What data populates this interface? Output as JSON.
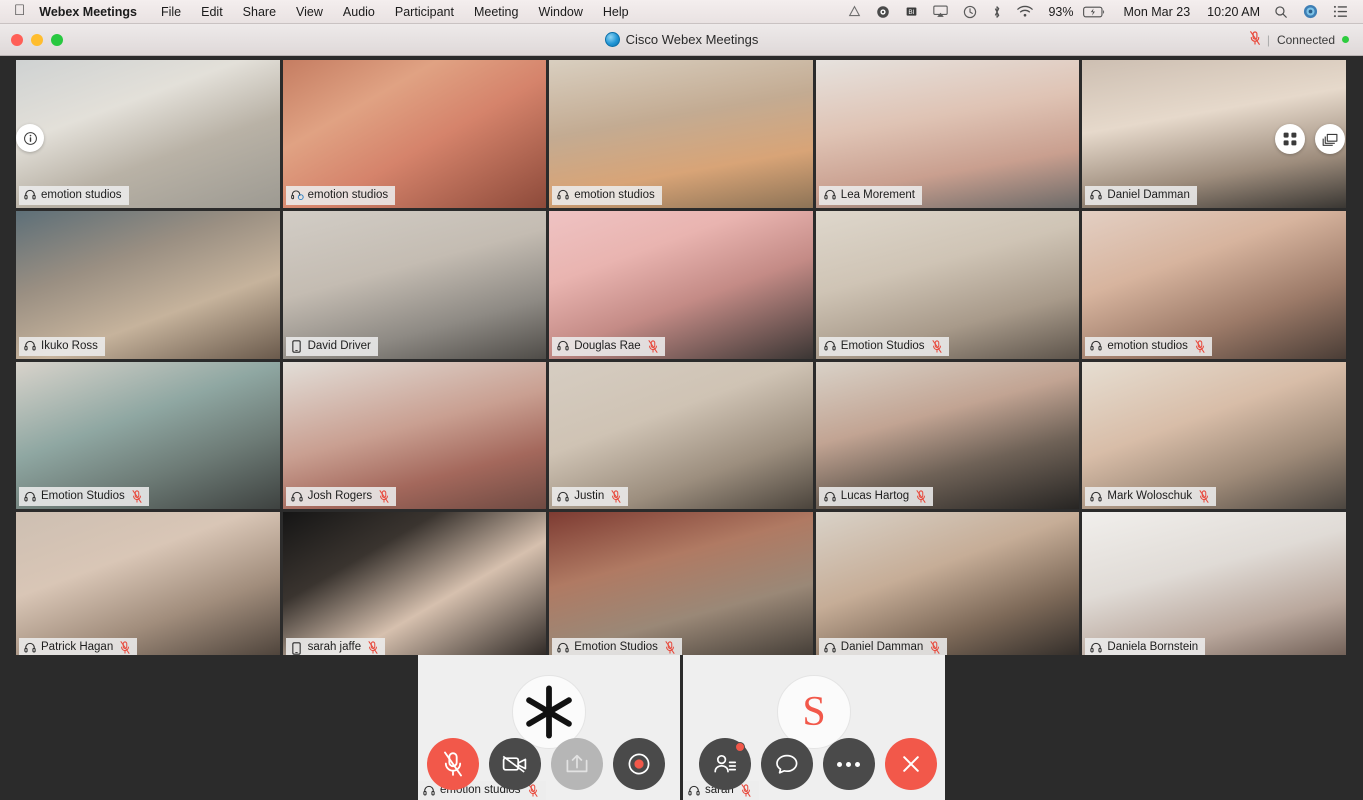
{
  "menubar": {
    "apple_icon": "apple-logo-icon",
    "items": [
      "Webex Meetings",
      "File",
      "Edit",
      "Share",
      "View",
      "Audio",
      "Participant",
      "Meeting",
      "Window",
      "Help"
    ],
    "status_icons": [
      "google-drive-icon",
      "creative-cloud-icon",
      "bi-icon",
      "airplay-icon",
      "time-machine-icon",
      "bluetooth-icon",
      "wifi-icon"
    ],
    "battery": "93%",
    "battery_icon": "battery-charging-icon",
    "date": "Mon Mar 23",
    "time": "10:20 AM",
    "right_icons": [
      "search-icon",
      "siri-icon",
      "control-center-icon"
    ]
  },
  "window": {
    "title": "Cisco Webex Meetings",
    "logo_icon": "webex-logo-icon",
    "mute_icon": "mic-muted-icon",
    "connection_status": "Connected",
    "connection_color": "#2ecc3f",
    "traffic_lights": [
      "close",
      "minimize",
      "maximize"
    ]
  },
  "stage": {
    "info_button_icon": "info-circle-icon",
    "layout_button_icon": "grid-layout-icon",
    "filmstrip_button_icon": "stacked-cards-icon",
    "active_border_color": "#62b8e2",
    "background_color": "#2b2b2b"
  },
  "participants": [
    {
      "name": "emotion studios",
      "device": "headset-icon",
      "muted": false,
      "active": true,
      "bg": "linear-gradient(160deg,#cfd2d2 0%,#e3e0d9 34%,#b9b2a6 62%,#9d9a92 100%)"
    },
    {
      "name": "emotion studios",
      "device": "headset-video-icon",
      "muted": false,
      "active": false,
      "bg": "linear-gradient(150deg,#c57d62 0%,#e0a283 30%,#d5836b 56%,#8d4a3a 100%)"
    },
    {
      "name": "emotion studios",
      "device": "headset-icon",
      "muted": false,
      "active": false,
      "bg": "linear-gradient(170deg,#d9cfc0 0%,#c3ab92 40%,#d8a477 70%,#8d7356 100%)"
    },
    {
      "name": "Lea Morement",
      "device": "headset-icon",
      "muted": false,
      "active": false,
      "bg": "linear-gradient(170deg,#e6e2de 0%,#dfc3b4 40%,#c99f8f 70%,#6c6a68 100%)"
    },
    {
      "name": "Daniel Damman",
      "device": "headset-icon",
      "muted": false,
      "active": false,
      "bg": "linear-gradient(170deg,#cdbfb2 0%,#e6d9cb 38%,#9d8c7c 72%,#3a3733 100%)"
    },
    {
      "name": "Ikuko Ross",
      "device": "headset-icon",
      "muted": false,
      "active": true,
      "bg": "linear-gradient(160deg,#5d6f78 0%,#9a8f82 35%,#c6b39c 65%,#6a5a4c 100%)"
    },
    {
      "name": "David Driver",
      "device": "phone-icon",
      "muted": false,
      "active": false,
      "bg": "linear-gradient(165deg,#d2cdc6 0%,#c4bcb2 40%,#8e8a84 72%,#4f4c48 100%)"
    },
    {
      "name": "Douglas Rae",
      "device": "headset-icon",
      "muted": true,
      "active": true,
      "bg": "linear-gradient(160deg,#efc3c3 0%,#e9b4b0 30%,#c48b86 58%,#3b3634 100%)"
    },
    {
      "name": "Emotion Studios",
      "device": "headset-icon",
      "muted": true,
      "active": false,
      "bg": "linear-gradient(165deg,#ded7cc 0%,#cfc4b5 38%,#a89a8a 70%,#5d544b 100%)"
    },
    {
      "name": "emotion studios",
      "device": "headset-icon",
      "muted": true,
      "active": true,
      "bg": "linear-gradient(160deg,#e3cfc3 0%,#d7b49e 35%,#9c7a68 68%,#4a3d36 100%)"
    },
    {
      "name": "Emotion Studios",
      "device": "headset-icon",
      "muted": true,
      "active": false,
      "bg": "linear-gradient(160deg,#d8d3cb 0%,#8fa7a2 40%,#6d7b76 68%,#3e4240 100%)"
    },
    {
      "name": "Josh Rogers",
      "device": "headset-icon",
      "muted": true,
      "active": false,
      "bg": "linear-gradient(165deg,#e2ded8 0%,#c99f91 45%,#a4685c 72%,#6e4a42 100%)"
    },
    {
      "name": "Justin",
      "device": "headset-icon",
      "muted": true,
      "active": false,
      "bg": "linear-gradient(160deg,#d6cdc2 0%,#cfc3b4 38%,#9c8e7e 70%,#4b443c 100%)"
    },
    {
      "name": "Lucas Hartog",
      "device": "headset-icon",
      "muted": true,
      "active": false,
      "bg": "linear-gradient(165deg,#d9d2c8 0%,#c2a493 38%,#6f6257 66%,#272523 100%)"
    },
    {
      "name": "Mark Woloschuk",
      "device": "headset-icon",
      "muted": true,
      "active": true,
      "bg": "linear-gradient(160deg,#e6ded2 0%,#d8bda8 40%,#9e8a78 70%,#4c4640 100%)"
    },
    {
      "name": "Patrick Hagan",
      "device": "headset-icon",
      "muted": true,
      "active": false,
      "bg": "linear-gradient(160deg,#cdbfb2 0%,#d9c6b6 35%,#a18d7c 66%,#4a4038 100%)"
    },
    {
      "name": "sarah jaffe",
      "device": "phone-icon",
      "muted": true,
      "active": false,
      "bg": "linear-gradient(150deg,#151515 0%,#3a342f 30%,#d6c0ae 60%,#2a2522 100%)"
    },
    {
      "name": "Emotion Studios",
      "device": "headset-icon",
      "muted": true,
      "active": false,
      "bg": "linear-gradient(165deg,#7d3b32 0%,#b07a63 35%,#9a8877 65%,#403a34 100%)"
    },
    {
      "name": "Daniel Damman",
      "device": "headset-icon",
      "muted": true,
      "active": false,
      "bg": "linear-gradient(160deg,#d9d2c8 0%,#c6ad97 40%,#7e6a59 70%,#2e2a27 100%)"
    },
    {
      "name": "Daniela Bornstein",
      "device": "headset-icon",
      "muted": false,
      "active": true,
      "bg": "linear-gradient(165deg,#f1efec 0%,#e0dbd6 40%,#b9a79c 72%,#6c5b52 100%)"
    }
  ],
  "selfviews": [
    {
      "name": "emotion studios",
      "device": "headset-icon",
      "muted": true,
      "avatar_type": "webex-logo",
      "avatar_letter": ""
    },
    {
      "name": "sarah",
      "device": "headset-icon",
      "muted": true,
      "avatar_type": "letter",
      "avatar_letter": "S"
    }
  ],
  "controls": [
    {
      "id": "mute-audio",
      "label": "Mute",
      "icon": "mic-muted-icon",
      "style": "red",
      "badge": false
    },
    {
      "id": "stop-video",
      "label": "Start video",
      "icon": "video-off-icon",
      "style": "dark",
      "badge": false
    },
    {
      "id": "share-content",
      "label": "Share content",
      "icon": "share-screen-icon",
      "style": "muted-light",
      "badge": false
    },
    {
      "id": "record",
      "label": "Record",
      "icon": "record-icon",
      "style": "dark",
      "badge": false
    },
    {
      "id": "participants",
      "label": "Participants",
      "icon": "participants-icon",
      "style": "dark",
      "badge": true
    },
    {
      "id": "chat",
      "label": "Chat",
      "icon": "chat-bubble-icon",
      "style": "dark",
      "badge": false
    },
    {
      "id": "more-options",
      "label": "More options",
      "icon": "ellipsis-icon",
      "style": "dark",
      "badge": false
    },
    {
      "id": "end-meeting",
      "label": "Leave meeting",
      "icon": "close-x-icon",
      "style": "endcall",
      "badge": false
    }
  ]
}
